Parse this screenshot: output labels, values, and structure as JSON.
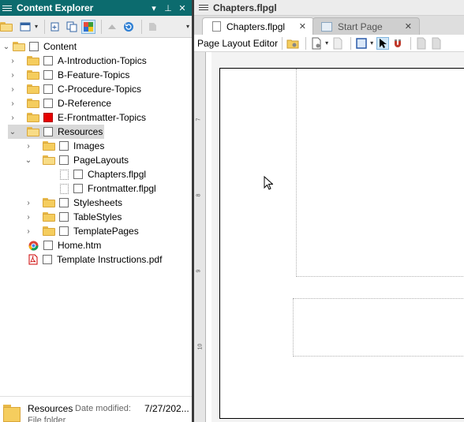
{
  "content_explorer": {
    "title": "Content Explorer",
    "pin_icon": "pin-icon",
    "close_label": "✕",
    "tree": [
      {
        "label": "Content",
        "kind": "folder-open",
        "expanded": true
      },
      {
        "label": "A-Introduction-Topics",
        "kind": "folder"
      },
      {
        "label": "B-Feature-Topics",
        "kind": "folder"
      },
      {
        "label": "C-Procedure-Topics",
        "kind": "folder"
      },
      {
        "label": "D-Reference",
        "kind": "folder"
      },
      {
        "label": "E-Frontmatter-Topics",
        "kind": "folder",
        "checkbox_color": "#e60000"
      },
      {
        "label": "Resources",
        "kind": "folder-open",
        "selected": true
      },
      {
        "label": "Images",
        "kind": "folder"
      },
      {
        "label": "PageLayouts",
        "kind": "folder-open"
      },
      {
        "label": "Chapters.flpgl",
        "kind": "file"
      },
      {
        "label": "Frontmatter.flpgl",
        "kind": "file"
      },
      {
        "label": "Stylesheets",
        "kind": "folder"
      },
      {
        "label": "TableStyles",
        "kind": "folder"
      },
      {
        "label": "TemplatePages",
        "kind": "folder"
      },
      {
        "label": "Home.htm",
        "kind": "file",
        "icon": "chrome-icon"
      },
      {
        "label": "Template Instructions.pdf",
        "kind": "file",
        "icon": "pdf-icon"
      }
    ],
    "status": {
      "name": "Resources",
      "date_label": "Date modified:",
      "date_value": "7/27/202...",
      "type": "File folder"
    }
  },
  "document": {
    "title": "Chapters.flpgl",
    "tabs": [
      {
        "label": "Chapters.flpgl",
        "active": true,
        "close": "✕"
      },
      {
        "label": "Start Page",
        "active": false,
        "close": "✕"
      }
    ],
    "editor_label": "Page Layout Editor",
    "ruler_numbers": [
      "7",
      "8",
      "9",
      "10"
    ]
  },
  "colors": {
    "pane_header": "#0c6b6e",
    "folder": "#f5cd5e",
    "selection": "#d9d9d9"
  }
}
